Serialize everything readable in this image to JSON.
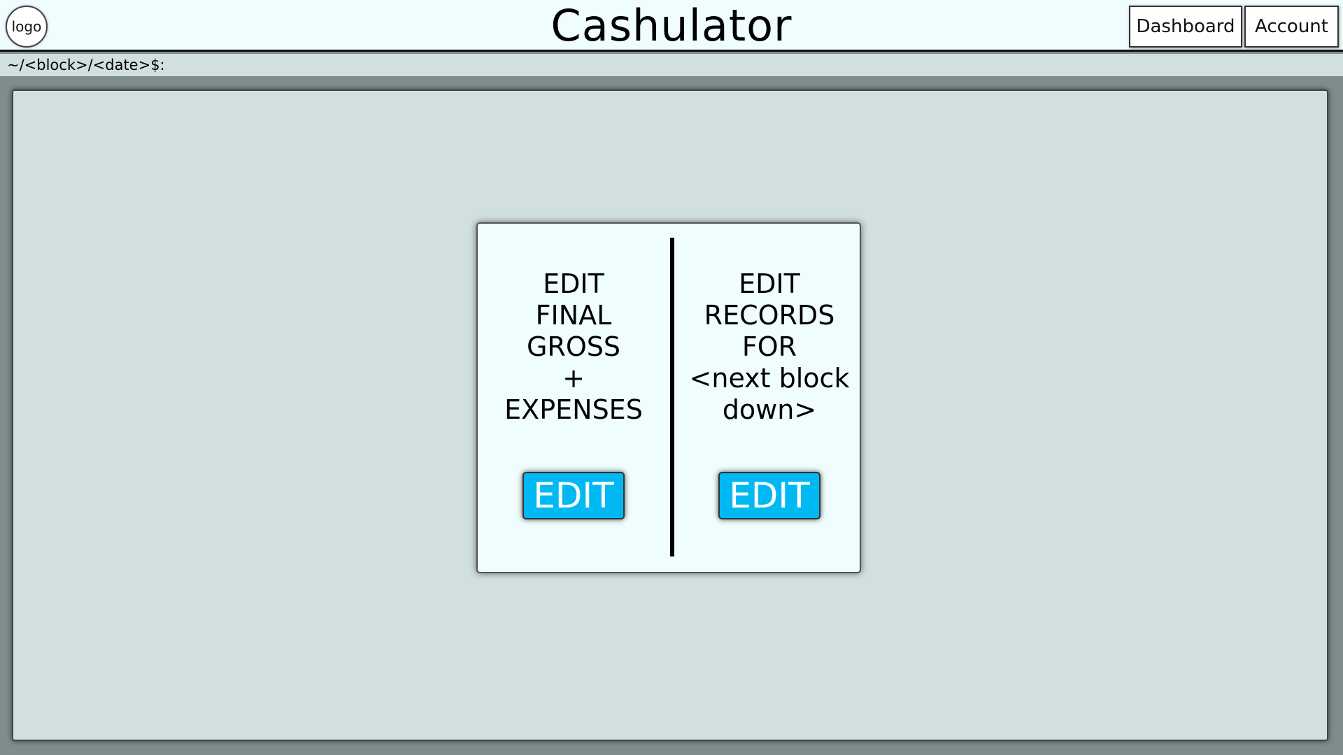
{
  "header": {
    "logo_label": "logo",
    "title": "Cashulator",
    "nav": {
      "dashboard_label": "Dashboard",
      "account_label": "Account"
    }
  },
  "breadcrumb": {
    "path": "~/<block>/<date>$:"
  },
  "card": {
    "left": {
      "text": "EDIT\nFINAL\nGROSS\n+\nEXPENSES",
      "button_label": "EDIT"
    },
    "right": {
      "text": "EDIT\nRECORDS\nFOR\n<next block\ndown>",
      "button_label": "EDIT"
    }
  },
  "colors": {
    "header_bg": "#f0fdfe",
    "panel_bg": "#d2dfe0",
    "frame_bg": "#7f8c8d",
    "button_bg": "#00b9f2",
    "button_text": "#ffffff"
  }
}
